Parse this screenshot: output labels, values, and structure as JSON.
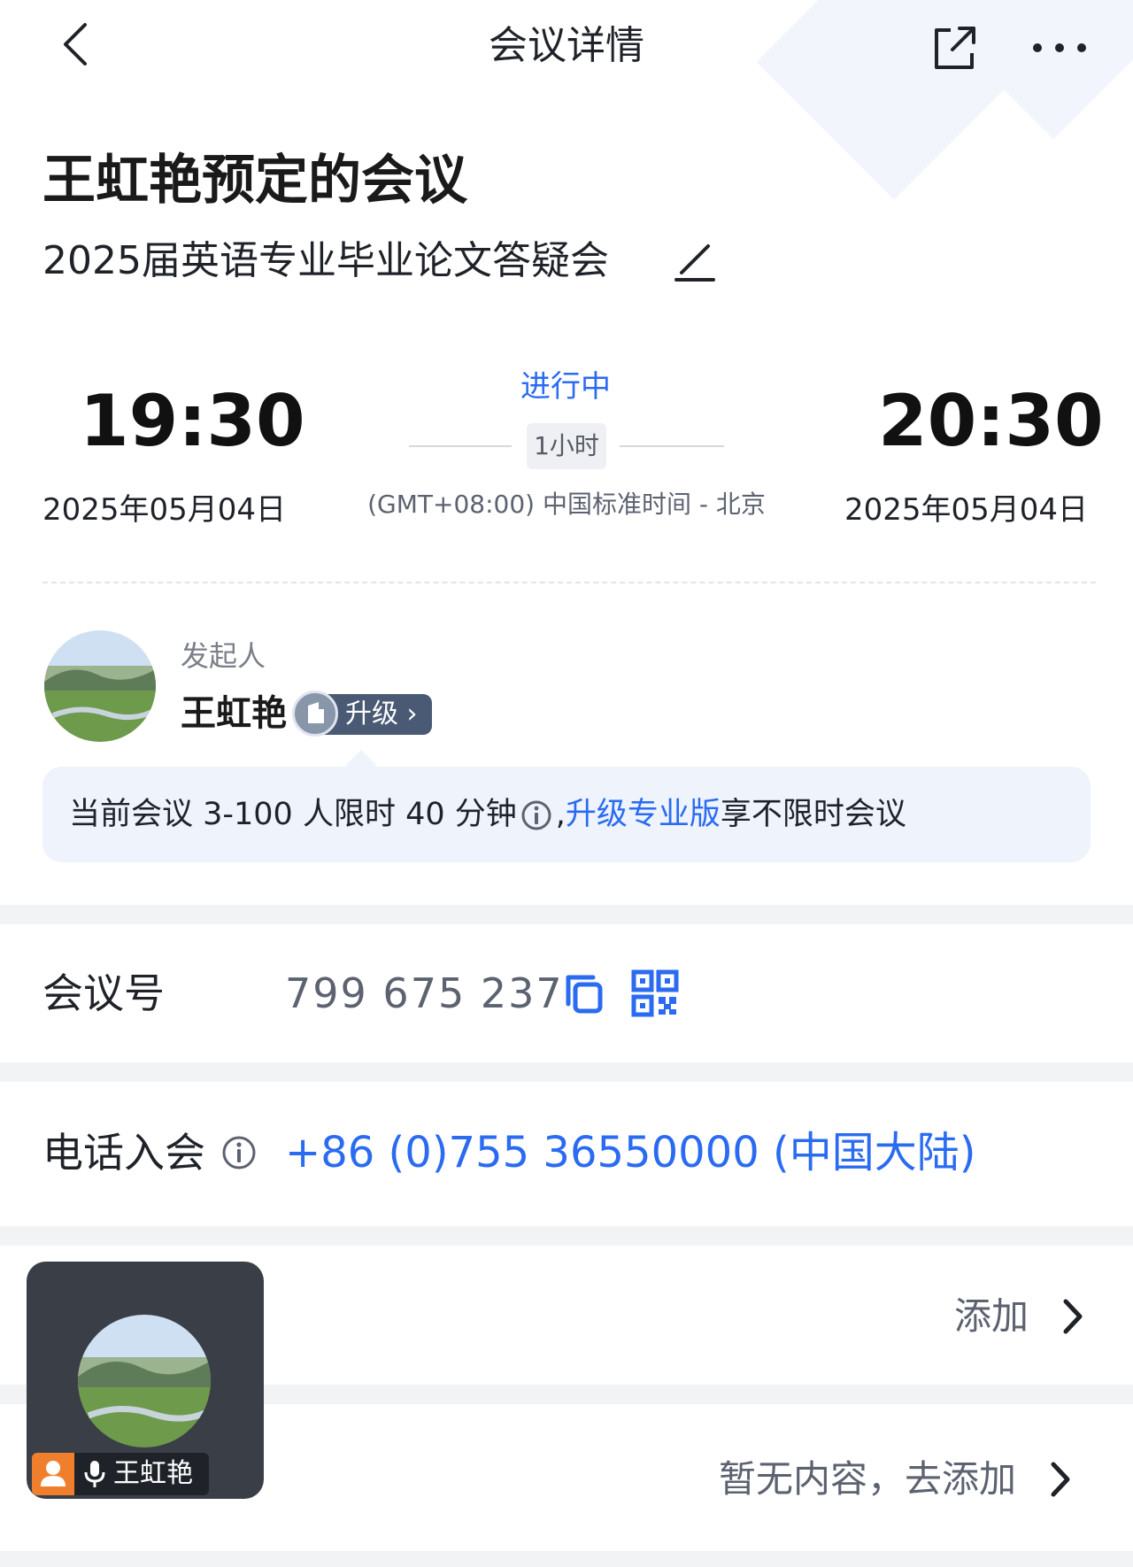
{
  "header": {
    "title": "会议详情",
    "back_icon": "back-chevron-icon",
    "share_icon": "share-icon",
    "more_icon": "more-icon"
  },
  "meeting": {
    "title": "王虹艳预定的会议",
    "subject": "2025届英语专业毕业论文答疑会",
    "start_time": "19:30",
    "end_time": "20:30",
    "start_date": "2025年05月04日",
    "end_date": "2025年05月04日",
    "status": "进行中",
    "duration": "1小时",
    "timezone": "(GMT+08:00) 中国标准时间 - 北京"
  },
  "host": {
    "label": "发起人",
    "name": "王虹艳",
    "upgrade_label": "升级",
    "upgrade_chevron": "›"
  },
  "tip": {
    "prefix": "当前会议 3-100 人限时 40 分钟",
    "comma": ",",
    "link": "升级专业版",
    "suffix": "享不限时会议"
  },
  "meeting_id": {
    "label": "会议号",
    "value": "799 675 237"
  },
  "phone": {
    "label": "电话入会",
    "value": "+86 (0)755 36550000 (中国大陆)"
  },
  "rows": {
    "add_label": "添加",
    "empty_label": "暂无内容，去添加"
  },
  "floating_video": {
    "name": "王虹艳"
  },
  "colors": {
    "accent": "#2a6bf2",
    "tip_bg": "#eef3fc",
    "badge": "#4a5a74",
    "user_icon": "#f07f2d"
  }
}
